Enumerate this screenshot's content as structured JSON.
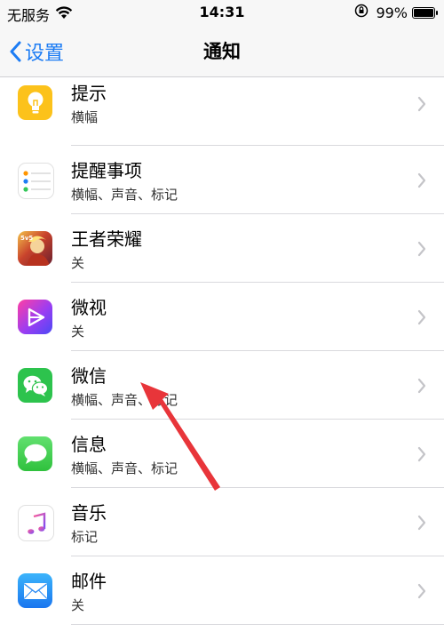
{
  "status": {
    "carrier": "无服务",
    "time": "14:31",
    "battery": "99%",
    "battery_level": 0.99
  },
  "nav": {
    "back_label": "设置",
    "title": "通知"
  },
  "apps": [
    {
      "name": "提示",
      "detail": "横幅",
      "icon": "tips-icon"
    },
    {
      "name": "提醒事项",
      "detail": "横幅、声音、标记",
      "icon": "reminders-icon"
    },
    {
      "name": "王者荣耀",
      "detail": "关",
      "icon": "honor-of-kings-icon"
    },
    {
      "name": "微视",
      "detail": "关",
      "icon": "weishi-icon"
    },
    {
      "name": "微信",
      "detail": "横幅、声音、标记",
      "icon": "wechat-icon"
    },
    {
      "name": "信息",
      "detail": "横幅、声音、标记",
      "icon": "messages-icon"
    },
    {
      "name": "音乐",
      "detail": "标记",
      "icon": "music-icon"
    },
    {
      "name": "邮件",
      "detail": "关",
      "icon": "mail-icon"
    }
  ],
  "colors": {
    "accent": "#1c7cf4",
    "annotation_arrow": "#e8353a"
  }
}
